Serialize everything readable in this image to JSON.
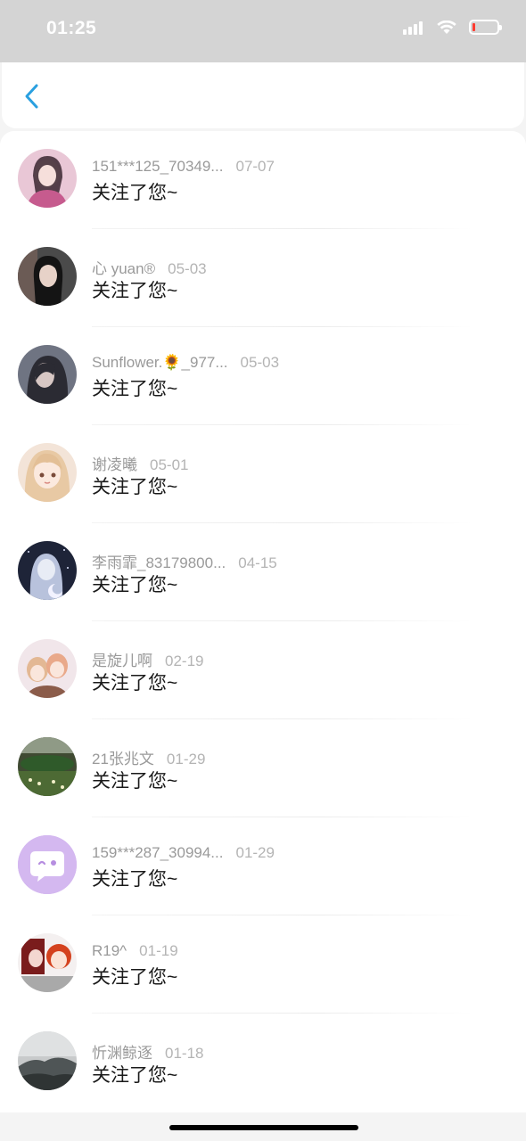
{
  "status_bar": {
    "time": "01:25",
    "icons": [
      "cellular-signal-icon",
      "wifi-icon",
      "battery-low-icon"
    ]
  },
  "nav": {
    "back_icon": "chevron-left-icon",
    "accent_color": "#2aa0e0"
  },
  "notifications": [
    {
      "name": "151***125_70349...",
      "date": "07-07",
      "message": "关注了您~"
    },
    {
      "name": "心 yuan®",
      "date": "05-03",
      "message": "关注了您~"
    },
    {
      "name": "Sunflower.🌻_977...",
      "date": "05-03",
      "message": "关注了您~"
    },
    {
      "name": "谢凌曦",
      "date": "05-01",
      "message": "关注了您~"
    },
    {
      "name": "李雨霏_83179800...",
      "date": "04-15",
      "message": "关注了您~"
    },
    {
      "name": "是旋儿啊",
      "date": "02-19",
      "message": "关注了您~"
    },
    {
      "name": "21张兆文",
      "date": "01-29",
      "message": "关注了您~"
    },
    {
      "name": "159***287_30994...",
      "date": "01-29",
      "message": "关注了您~"
    },
    {
      "name": "R19^",
      "date": "01-19",
      "message": "关注了您~"
    },
    {
      "name": "忻渊鲸逐",
      "date": "01-18",
      "message": "关注了您~"
    }
  ],
  "colors": {
    "name_text": "#9a9a9a",
    "message_text": "#1a1a1a",
    "default_avatar_bg": "#d4b8f0"
  }
}
